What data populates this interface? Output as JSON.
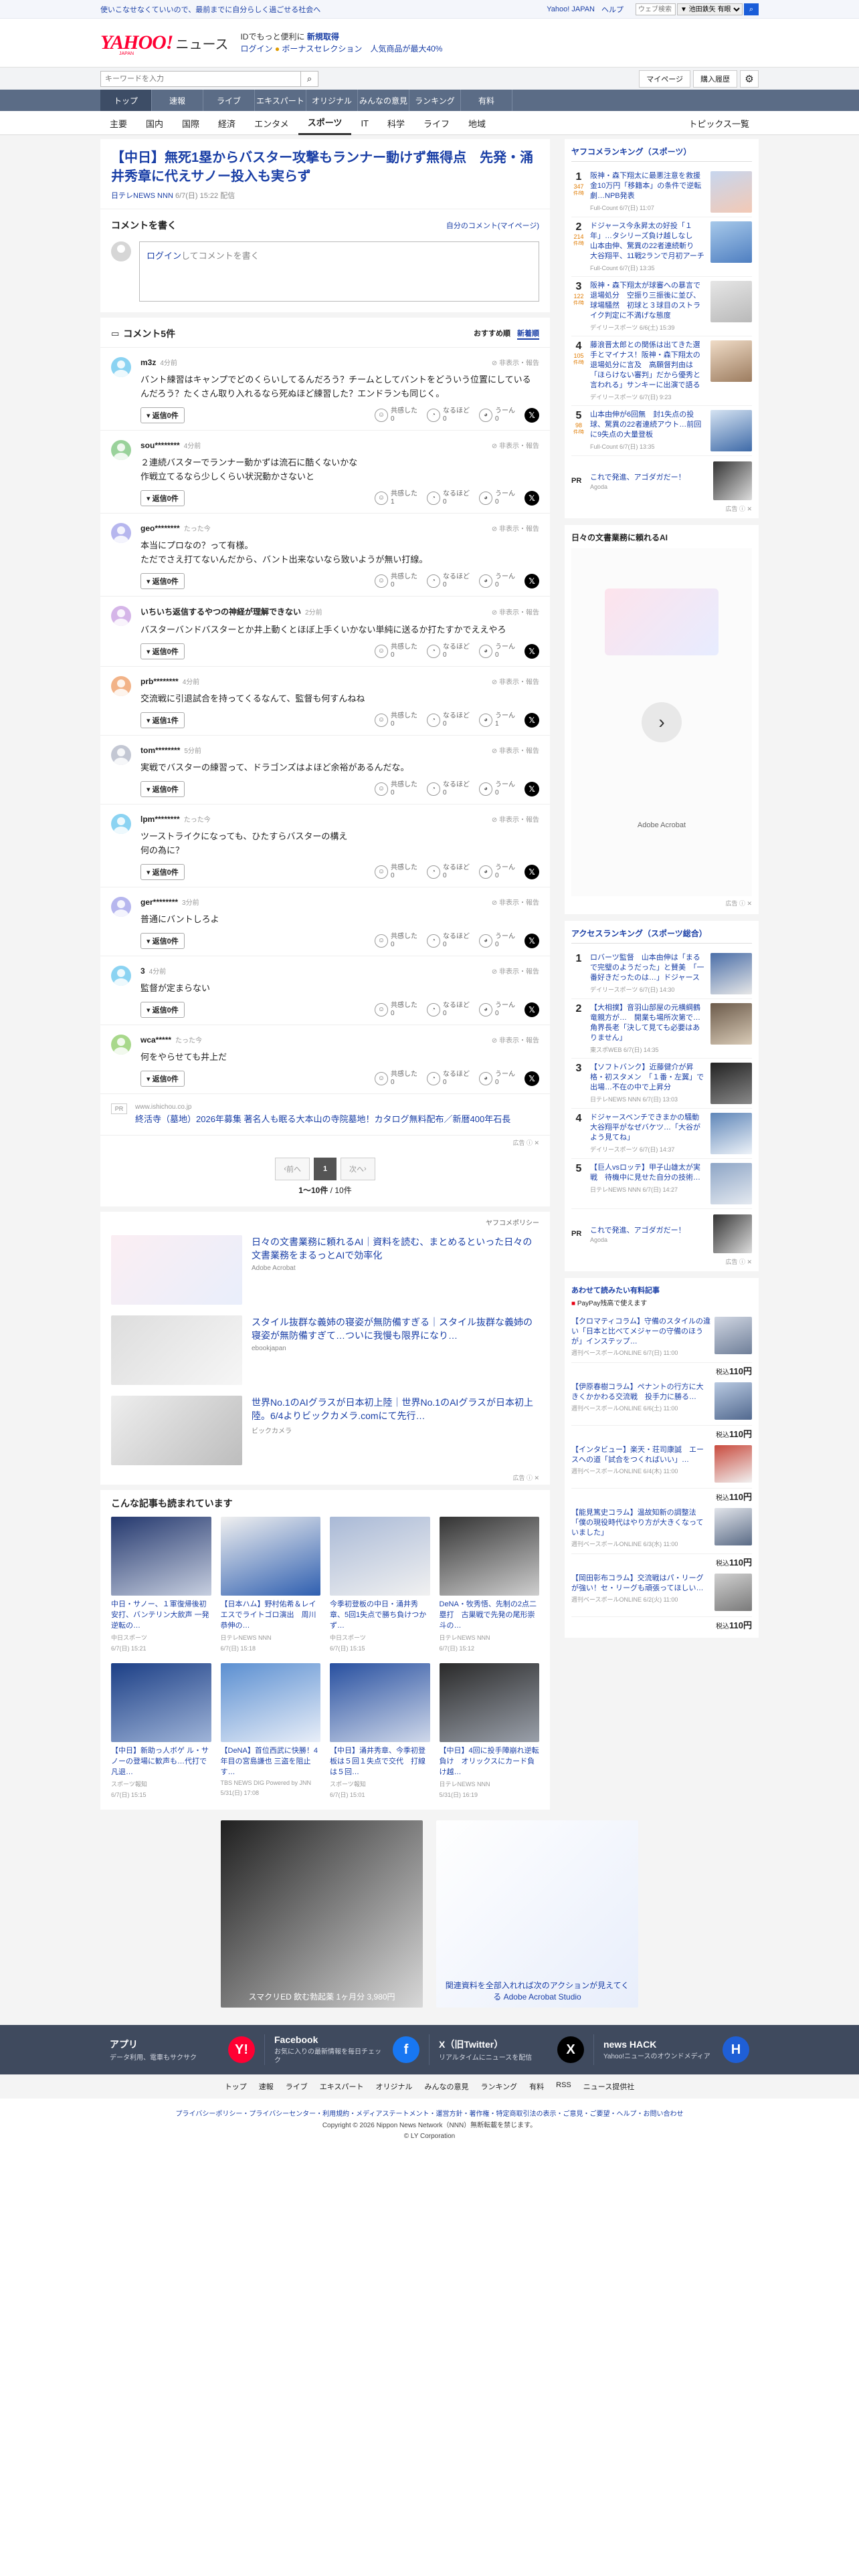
{
  "topstrip": {
    "promo": "使いこなせなくていいので、最前までに自分らしく過ごせる社会へ",
    "links": [
      "Yahoo! JAPAN",
      "ヘルプ"
    ],
    "search_placeholder": "ウェブ検索",
    "search_option": "▼ 池田鉄矢 有眼"
  },
  "header": {
    "logo": "YAHOO!",
    "logo_sub": "JAPAN",
    "section": "ニュース",
    "line1_prefix": "IDでもっと便利に",
    "line1_link": "新規取得",
    "login": "ログイン",
    "bonus": "ボーナスセレクション",
    "bonus_tail": "人気商品が最大40%"
  },
  "searchrow": {
    "placeholder": "キーワードを入力",
    "mypage": "マイページ",
    "purchase": "購入履歴"
  },
  "categories": [
    "トップ",
    "速報",
    "ライブ",
    "エキスパート",
    "オリジナル",
    "みんなの意見",
    "ランキング",
    "有料"
  ],
  "topics": [
    "主要",
    "国内",
    "国際",
    "経済",
    "エンタメ",
    "スポーツ",
    "IT",
    "科学",
    "ライフ",
    "地域"
  ],
  "topics_active": "スポーツ",
  "topics_list": "トピックス一覧",
  "article": {
    "title": "【中日】無死1塁からバスター攻撃もランナー動けず無得点　先発・涌井秀章に代えサノー投入も実らず",
    "source": "日テレNEWS NNN",
    "date": "6/7(日) 15:22 配信"
  },
  "compose": {
    "title": "コメントを書く",
    "mine": "自分のコメント(マイページ)",
    "login_link": "ログイン",
    "placeholder_tail": "してコメントを書く"
  },
  "comments_header": {
    "title": "コメント5件",
    "sort_recommended": "おすすめ順",
    "sort_new": "新着順"
  },
  "comment_labels": {
    "hide": "非表示・報告",
    "reply": "返信0件",
    "reply1": "返信1件",
    "agree": "共感した",
    "think": "なるほど",
    "hmm": "うーん"
  },
  "comments": [
    {
      "user": "m3z",
      "time": "4分前",
      "color": "#8bd3f2",
      "text": "バント練習はキャンプでどのくらいしてるんだろう？チームとしてバントをどういう位置にしているんだろう？たくさん取り入れるなら死ぬほど練習した？エンドランも同じく。",
      "reply": "返信0件",
      "agree": "0",
      "think": "0",
      "hmm": "0"
    },
    {
      "user": "sou********",
      "time": "4分前",
      "color": "#9ad29b",
      "text": "２連続バスターでランナー動かずは流石に酷くないかな\n作戦立てるなら少しくらい状況動かさないと",
      "reply": "返信0件",
      "agree": "1",
      "think": "0",
      "hmm": "0"
    },
    {
      "user": "geo********",
      "time": "たった今",
      "color": "#b6b6ee",
      "text": "本当にプロなの？って有様。\nただでさえ打てないんだから、バント出来ないなら致いようが無い打線。",
      "reply": "返信0件",
      "agree": "0",
      "think": "0",
      "hmm": "0"
    },
    {
      "user": "いちいち返信するやつの神経が理解できない",
      "time": "2分前",
      "color": "#d5b5e8",
      "text": "バスターバンドバスターとか井上動くとほぼ上手くいかない単純に送るか打たすかでええやろ",
      "reply": "返信0件",
      "agree": "0",
      "think": "0",
      "hmm": "0"
    },
    {
      "user": "prb********",
      "time": "4分前",
      "color": "#f2b388",
      "text": "交流戦に引退試合を持ってくるなんて、監督も何すんねね",
      "reply": "返信1件",
      "agree": "0",
      "think": "0",
      "hmm": "1"
    },
    {
      "user": "tom********",
      "time": "5分前",
      "color": "#c3c7d3",
      "text": "実戦でバスターの練習って、ドラゴンズはよほど余裕があるんだな。",
      "reply": "返信0件",
      "agree": "0",
      "think": "0",
      "hmm": "0"
    },
    {
      "user": "lpm********",
      "time": "たった今",
      "color": "#8bd3f2",
      "text": "ツーストライクになっても、ひたすらバスターの構え\n何の為に？",
      "reply": "返信0件",
      "agree": "0",
      "think": "0",
      "hmm": "0"
    },
    {
      "user": "ger********",
      "time": "3分前",
      "color": "#b6b6ee",
      "text": "普通にバントしろよ",
      "reply": "返信0件",
      "agree": "0",
      "think": "0",
      "hmm": "0"
    },
    {
      "user": "3",
      "time": "4分前",
      "color": "#8bd3f2",
      "text": "監督が定まらない",
      "reply": "返信0件",
      "agree": "0",
      "think": "0",
      "hmm": "0"
    },
    {
      "user": "wca*****",
      "time": "たった今",
      "color": "#a8d88b",
      "text": "何をやらせても井上だ",
      "reply": "返信0件",
      "agree": "0",
      "think": "0",
      "hmm": "0"
    }
  ],
  "pr_inline": {
    "tag": "PR",
    "domain": "www.ishichou.co.jp",
    "title": "終活寺（墓地）2026年募集 著名人も眠る大本山の寺院墓地！カタログ無料配布／新暦400年石長"
  },
  "ad_note": "広告",
  "pager": {
    "prev": "前へ",
    "current": "1",
    "next": "次へ",
    "count_range": "1〜10件",
    "count_total": "10件"
  },
  "ad_policy": "ヤフコメポリシー",
  "ads": [
    {
      "title": "日々の文書業務に頼れるAI｜資料を読む、まとめるといった日々の文書業務をまるっとAIで効率化",
      "sponsor": "Adobe Acrobat",
      "color1": "#fbeef3",
      "color2": "#e9eefb"
    },
    {
      "title": "スタイル抜群な義姉の寝姿が無防備すぎる｜スタイル抜群な義姉の寝姿が無防備すぎて…ついに我慢も限界になり…",
      "sponsor": "ebookjapan",
      "color1": "#dddddd",
      "color2": "#f6f6f6"
    },
    {
      "title": "世界No.1のAIグラスが日本初上陸｜世界No.1のAIグラスが日本初上陸。6/4よりビックカメラ.comにて先行…",
      "sponsor": "ビックカメラ",
      "color1": "#eeeeee",
      "color2": "#bdbdbd"
    }
  ],
  "related": {
    "title": "こんな記事も読まれています",
    "items": [
      {
        "title": "中日・サノー、１軍復帰後初安打、バンテリン大飲声 一発逆転の…",
        "source": "中日スポーツ",
        "date": "6/7(日) 15:21",
        "c1": "#24386e",
        "c2": "#c7cfe0"
      },
      {
        "title": "【日本ハム】野村佑希＆レイエスでライトゴロ演出　周川恭伸の…",
        "source": "日テレNEWS NNN",
        "date": "6/7(日) 15:18",
        "c1": "#f0f0f0",
        "c2": "#2f5fb0"
      },
      {
        "title": "今季初登板の中日・涌井秀章、5回1失点で勝ち負けつかず…",
        "source": "中日スポーツ",
        "date": "6/7(日) 15:15",
        "c1": "#a9b9d6",
        "c2": "#f1f1f1"
      },
      {
        "title": "DeNA・牧秀悟、先制の2点二塁打　古巣戦で先発の尾形崇斗の…",
        "source": "日テレNEWS NNN",
        "date": "6/7(日) 15:12",
        "c1": "#333333",
        "c2": "#cfcfcf"
      },
      {
        "title": "【中日】新助っ人ボゲ ル・サノーの登場に歓声も…代打で凡退…",
        "source": "スポーツ報知",
        "date": "6/7(日) 15:15",
        "c1": "#1c3f86",
        "c2": "#9fb4d8"
      },
      {
        "title": "【DeNA】首位西武に快勝！4年目の宮島謙也 三盗を阻止す…",
        "source": "TBS NEWS DIG Powered by JNN",
        "date": "5/31(日) 17:08",
        "c1": "#5b8fd1",
        "c2": "#e8eef8"
      },
      {
        "title": "【中日】涌井秀章、今季初登板は５回１失点で交代　打線は５回…",
        "source": "スポーツ報知",
        "date": "6/7(日) 15:01",
        "c1": "#2850a0",
        "c2": "#cfd8ea"
      },
      {
        "title": "【中日】4回に投手陣崩れ逆転負け　オリックスにカード負け越…",
        "source": "日テレNEWS NNN",
        "date": "5/31(日) 16:19",
        "c1": "#2a2a2a",
        "c2": "#9aa0aa"
      }
    ]
  },
  "bottom_ads": [
    {
      "label": "スマクリED 飲む勃起薬 1ヶ月分 3,980円",
      "c1": "#1f1f1f",
      "c2": "#d8d8d8"
    },
    {
      "label": "関連資料を全部入れれば次のアクションが見えてくる Adobe Acrobat Studio",
      "c1": "#ffffff",
      "c2": "#e8eefb"
    }
  ],
  "side_rank": {
    "title": "ヤフコメランキング（スポーツ）",
    "count_label": "件/時",
    "items": [
      {
        "n": "1",
        "c": "347",
        "title": "阪神・森下翔太に最悪注意を救援金10万円「移籍本」の条件で逆転劇…NPB発表",
        "source": "Full-Count 6/7(日) 11:07",
        "t1": "#c7d6ee",
        "t2": "#f3c9b5"
      },
      {
        "n": "2",
        "c": "214",
        "title": "ドジャース今永昇太の好投「１年」…タシリーズ負け越しなし　山本由伸、驚異の22者連続斬り　大谷翔平、11戦2ランで月初アーチ",
        "source": "Full-Count 6/7(日) 13:35",
        "t1": "#a7c9ea",
        "t2": "#4f7fc1"
      },
      {
        "n": "3",
        "c": "122",
        "title": "阪神・森下翔太が球審への暴言で退場処分　空振り三振後に並び、球場騒然　初球と３球目のストライク判定に不満げな態度",
        "source": "デイリースポーツ 6/6(土) 15:39",
        "t1": "#e6e6e6",
        "t2": "#b9b9b9"
      },
      {
        "n": "4",
        "c": "105",
        "title": "藤浪晋太郎との関係は出てきた選手とマイナス！阪神・森下翔太の退場処分に言及　高願督判由は「ほらけない審判」だから優秀と言われる」サンキーに出演で語る",
        "source": "デイリースポーツ 6/7(日) 9:23",
        "t1": "#f0dcc7",
        "t2": "#9c7c5f"
      },
      {
        "n": "5",
        "c": "98",
        "title": "山本由伸が6回無　封1失点の投球、驚異の22者連続アウト…前回に9失点の大量登板",
        "source": "Full-Count 6/7(日) 13:35",
        "t1": "#d5e3f2",
        "t2": "#3e6aa8"
      }
    ],
    "pr": {
      "tag": "PR",
      "title": "これで発進、アゴダガだー！",
      "source": "Agoda"
    }
  },
  "side_ai": {
    "title": "日々の文書業務に頼れるAI",
    "brand": "Adobe Acrobat"
  },
  "side_access": {
    "title": "アクセスランキング（スポーツ総合）",
    "items": [
      {
        "n": "1",
        "title": "ロバーツ監督　山本由伸は「まるで完璧のようだった」と賛美　「一番好きだったのは…」ドジャース",
        "source": "デイリースポーツ 6/7(日) 14:30",
        "t1": "#4a6ea8",
        "t2": "#e7e7e7"
      },
      {
        "n": "2",
        "title": "【大相撲】音羽山部屋の元横綱鶴竜親方が…　開業も場所次第で…角界長老「決して見ても必要はありません」",
        "source": "東スポWEB 6/7(日) 14:35",
        "t1": "#6b5a4a",
        "t2": "#d9cbb7"
      },
      {
        "n": "3",
        "title": "【ソフトバンク】近藤健介が昇格・初スタメン　「１番・左翼」で出場…不在の中で上昇分",
        "source": "日テレNEWS NNN 6/7(日) 13:03",
        "t1": "#222222",
        "t2": "#898989"
      },
      {
        "n": "4",
        "title": "ドジャースベンチできまかの騒動　大谷翔平がなぜバケツ…「大谷がよう見てね」",
        "source": "デイリースポーツ 6/7(日) 14:37",
        "t1": "#5f86b8",
        "t2": "#edf2f8"
      },
      {
        "n": "5",
        "title": "【巨人vsロッテ】甲子山雄太が実戦　待機中に見せた自分の技術…",
        "source": "日テレNEWS NNN 6/7(日) 14:27",
        "t1": "#8da5c6",
        "t2": "#e4e9f0"
      }
    ],
    "pr": {
      "tag": "PR",
      "title": "これで発進、アゴダガだー！",
      "source": "Agoda"
    }
  },
  "side_paypay": {
    "title": "あわせて読みたい有料記事",
    "sub_prefix": "PayPay残高",
    "sub_tail": "で使えます",
    "price_prefix": "税込",
    "items": [
      {
        "title": "【クロマティコラム】守備のスタイルの違い「日本と比べてメジャーの守備のほうが」インステップ…",
        "source": "週刊ベースボールONLINE 6/7(日) 11:00",
        "price": "110円",
        "t1": "#d0d6e2",
        "t2": "#6f7f99"
      },
      {
        "title": "【伊原春樹コラム】ペナントの行方に大きくかかわる交流戦　投手力に勝る…",
        "source": "週刊ベースボールONLINE 6/6(土) 11:00",
        "price": "110円",
        "t1": "#b8c9e1",
        "t2": "#52698f"
      },
      {
        "title": "【インタビュー】楽天・荘司康誠　エースへの道「試合をつくればいい」…",
        "source": "週刊ベースボールONLINE 6/4(木) 11:00",
        "price": "110円",
        "t1": "#c94b3e",
        "t2": "#f1f1f1"
      },
      {
        "title": "【能見篤史コラム】温故知新の調整法「僕の現役時代はやり方が大きくなっていました」",
        "source": "週刊ベースボールONLINE 6/3(水) 11:00",
        "price": "110円",
        "t1": "#e1e4ea",
        "t2": "#5a6b86"
      },
      {
        "title": "【岡田彰布コラム】交流戦はパ・リーグが強い！セ・リーグも頑張ってほしい…",
        "source": "週刊ベースボールONLINE 6/2(火) 11:00",
        "price": "110円",
        "t1": "#d0d0d0",
        "t2": "#7a7a7a"
      }
    ]
  },
  "apps": [
    {
      "name": "アプリ",
      "desc": "データ利用、電車もサクサク",
      "icon": "Y!",
      "icolor": "#ffffff",
      "ibg": "#ff0033"
    },
    {
      "name": "Facebook",
      "desc": "お気に入りの最新情報を毎日チェック",
      "icon": "f",
      "icolor": "#ffffff",
      "ibg": "#1877f2"
    },
    {
      "name": "X（旧Twitter）",
      "desc": "リアルタイムにニュースを配信",
      "icon": "X",
      "icolor": "#ffffff",
      "ibg": "#000000"
    },
    {
      "name": "news HACK",
      "desc": "Yahoo!ニュースのオウンドメディア",
      "icon": "H",
      "icolor": "#ffffff",
      "ibg": "#1f5fd6"
    }
  ],
  "footer_nav": [
    "トップ",
    "速報",
    "ライブ",
    "エキスパート",
    "オリジナル",
    "みんなの意見",
    "ランキング",
    "有料",
    "RSS",
    "ニュース提供社"
  ],
  "footer_links": "プライバシーポリシー・プライバシーセンター・利用規約・メディアステートメント・運営方針・著作権・特定商取引法の表示・ご意見・ご要望・ヘルプ・お問い合わせ",
  "copyright": "Copyright © 2026 Nippon News Network（NNN）無断転載を禁じます。",
  "copyright2": "© LY Corporation"
}
